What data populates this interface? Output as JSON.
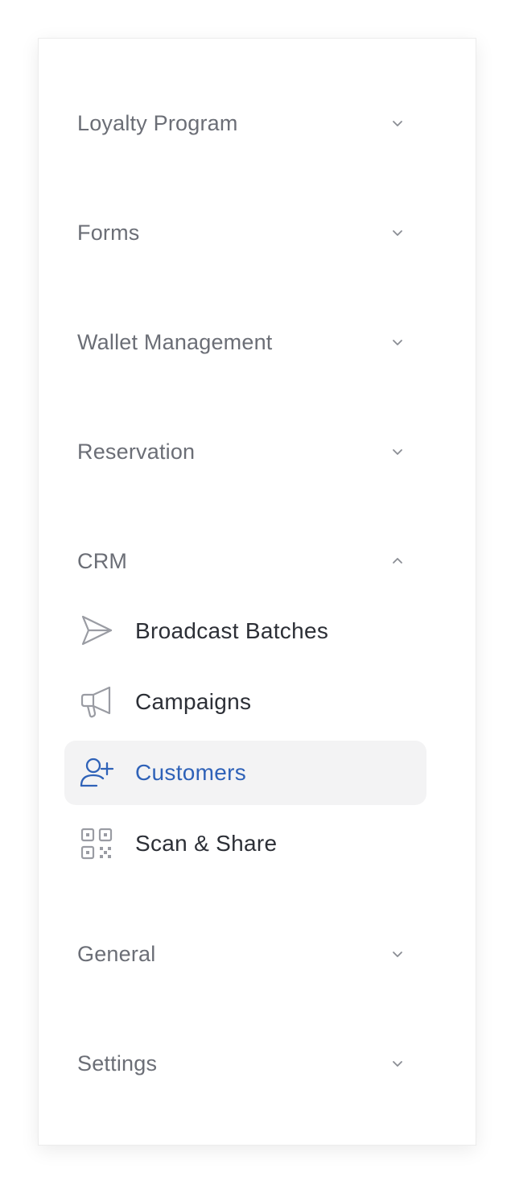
{
  "sections": [
    {
      "label": "Loyalty Program",
      "expanded": false
    },
    {
      "label": "Forms",
      "expanded": false
    },
    {
      "label": "Wallet Management",
      "expanded": false
    },
    {
      "label": "Reservation",
      "expanded": false
    },
    {
      "label": "CRM",
      "expanded": true
    },
    {
      "label": "General",
      "expanded": false
    },
    {
      "label": "Settings",
      "expanded": false
    }
  ],
  "crm_items": [
    {
      "label": "Broadcast Batches",
      "icon": "send-icon",
      "active": false
    },
    {
      "label": "Campaigns",
      "icon": "megaphone-icon",
      "active": false
    },
    {
      "label": "Customers",
      "icon": "user-plus-icon",
      "active": true
    },
    {
      "label": "Scan & Share",
      "icon": "qr-code-icon",
      "active": false
    }
  ],
  "colors": {
    "section_text": "#6b6e76",
    "item_text": "#2c2f36",
    "active_text": "#2f62b8",
    "active_bg": "#f3f3f4",
    "icon_gray": "#9a9ca3"
  }
}
